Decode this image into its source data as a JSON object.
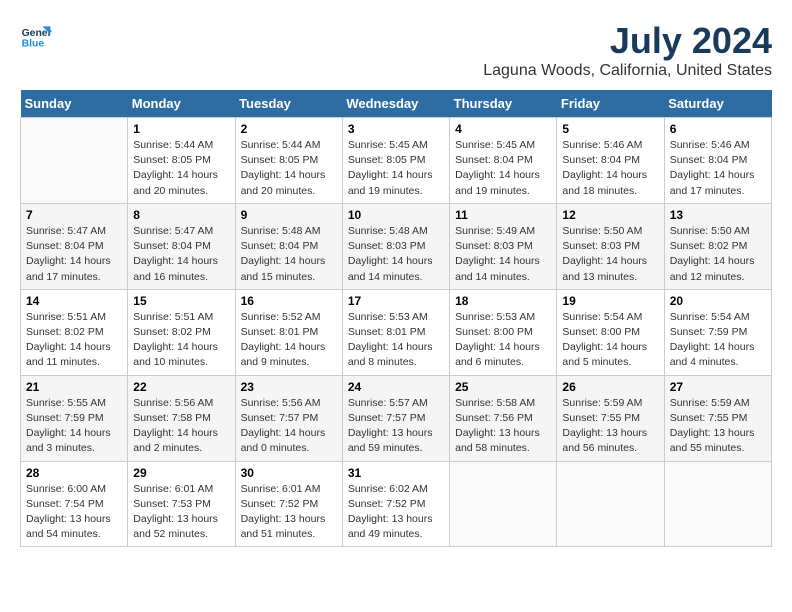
{
  "logo": {
    "line1": "General",
    "line2": "Blue"
  },
  "title": "July 2024",
  "subtitle": "Laguna Woods, California, United States",
  "days_header": [
    "Sunday",
    "Monday",
    "Tuesday",
    "Wednesday",
    "Thursday",
    "Friday",
    "Saturday"
  ],
  "weeks": [
    [
      {
        "day": "",
        "info": ""
      },
      {
        "day": "1",
        "info": "Sunrise: 5:44 AM\nSunset: 8:05 PM\nDaylight: 14 hours\nand 20 minutes."
      },
      {
        "day": "2",
        "info": "Sunrise: 5:44 AM\nSunset: 8:05 PM\nDaylight: 14 hours\nand 20 minutes."
      },
      {
        "day": "3",
        "info": "Sunrise: 5:45 AM\nSunset: 8:05 PM\nDaylight: 14 hours\nand 19 minutes."
      },
      {
        "day": "4",
        "info": "Sunrise: 5:45 AM\nSunset: 8:04 PM\nDaylight: 14 hours\nand 19 minutes."
      },
      {
        "day": "5",
        "info": "Sunrise: 5:46 AM\nSunset: 8:04 PM\nDaylight: 14 hours\nand 18 minutes."
      },
      {
        "day": "6",
        "info": "Sunrise: 5:46 AM\nSunset: 8:04 PM\nDaylight: 14 hours\nand 17 minutes."
      }
    ],
    [
      {
        "day": "7",
        "info": "Sunrise: 5:47 AM\nSunset: 8:04 PM\nDaylight: 14 hours\nand 17 minutes."
      },
      {
        "day": "8",
        "info": "Sunrise: 5:47 AM\nSunset: 8:04 PM\nDaylight: 14 hours\nand 16 minutes."
      },
      {
        "day": "9",
        "info": "Sunrise: 5:48 AM\nSunset: 8:04 PM\nDaylight: 14 hours\nand 15 minutes."
      },
      {
        "day": "10",
        "info": "Sunrise: 5:48 AM\nSunset: 8:03 PM\nDaylight: 14 hours\nand 14 minutes."
      },
      {
        "day": "11",
        "info": "Sunrise: 5:49 AM\nSunset: 8:03 PM\nDaylight: 14 hours\nand 14 minutes."
      },
      {
        "day": "12",
        "info": "Sunrise: 5:50 AM\nSunset: 8:03 PM\nDaylight: 14 hours\nand 13 minutes."
      },
      {
        "day": "13",
        "info": "Sunrise: 5:50 AM\nSunset: 8:02 PM\nDaylight: 14 hours\nand 12 minutes."
      }
    ],
    [
      {
        "day": "14",
        "info": "Sunrise: 5:51 AM\nSunset: 8:02 PM\nDaylight: 14 hours\nand 11 minutes."
      },
      {
        "day": "15",
        "info": "Sunrise: 5:51 AM\nSunset: 8:02 PM\nDaylight: 14 hours\nand 10 minutes."
      },
      {
        "day": "16",
        "info": "Sunrise: 5:52 AM\nSunset: 8:01 PM\nDaylight: 14 hours\nand 9 minutes."
      },
      {
        "day": "17",
        "info": "Sunrise: 5:53 AM\nSunset: 8:01 PM\nDaylight: 14 hours\nand 8 minutes."
      },
      {
        "day": "18",
        "info": "Sunrise: 5:53 AM\nSunset: 8:00 PM\nDaylight: 14 hours\nand 6 minutes."
      },
      {
        "day": "19",
        "info": "Sunrise: 5:54 AM\nSunset: 8:00 PM\nDaylight: 14 hours\nand 5 minutes."
      },
      {
        "day": "20",
        "info": "Sunrise: 5:54 AM\nSunset: 7:59 PM\nDaylight: 14 hours\nand 4 minutes."
      }
    ],
    [
      {
        "day": "21",
        "info": "Sunrise: 5:55 AM\nSunset: 7:59 PM\nDaylight: 14 hours\nand 3 minutes."
      },
      {
        "day": "22",
        "info": "Sunrise: 5:56 AM\nSunset: 7:58 PM\nDaylight: 14 hours\nand 2 minutes."
      },
      {
        "day": "23",
        "info": "Sunrise: 5:56 AM\nSunset: 7:57 PM\nDaylight: 14 hours\nand 0 minutes."
      },
      {
        "day": "24",
        "info": "Sunrise: 5:57 AM\nSunset: 7:57 PM\nDaylight: 13 hours\nand 59 minutes."
      },
      {
        "day": "25",
        "info": "Sunrise: 5:58 AM\nSunset: 7:56 PM\nDaylight: 13 hours\nand 58 minutes."
      },
      {
        "day": "26",
        "info": "Sunrise: 5:59 AM\nSunset: 7:55 PM\nDaylight: 13 hours\nand 56 minutes."
      },
      {
        "day": "27",
        "info": "Sunrise: 5:59 AM\nSunset: 7:55 PM\nDaylight: 13 hours\nand 55 minutes."
      }
    ],
    [
      {
        "day": "28",
        "info": "Sunrise: 6:00 AM\nSunset: 7:54 PM\nDaylight: 13 hours\nand 54 minutes."
      },
      {
        "day": "29",
        "info": "Sunrise: 6:01 AM\nSunset: 7:53 PM\nDaylight: 13 hours\nand 52 minutes."
      },
      {
        "day": "30",
        "info": "Sunrise: 6:01 AM\nSunset: 7:52 PM\nDaylight: 13 hours\nand 51 minutes."
      },
      {
        "day": "31",
        "info": "Sunrise: 6:02 AM\nSunset: 7:52 PM\nDaylight: 13 hours\nand 49 minutes."
      },
      {
        "day": "",
        "info": ""
      },
      {
        "day": "",
        "info": ""
      },
      {
        "day": "",
        "info": ""
      }
    ]
  ]
}
